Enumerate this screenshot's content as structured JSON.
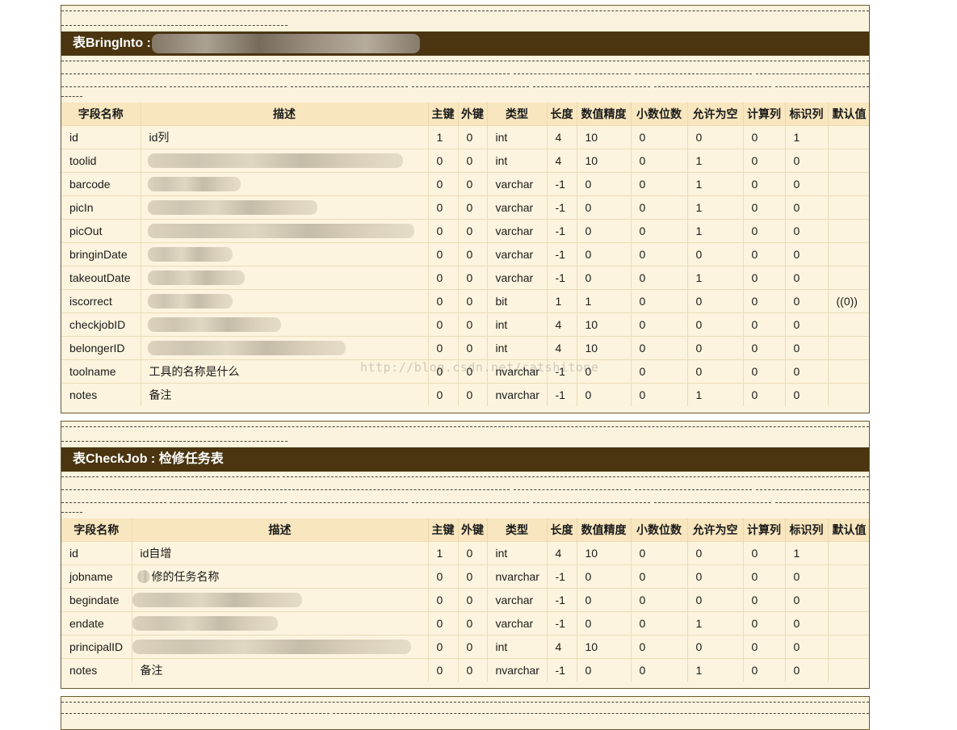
{
  "watermark": "http://blog.csdn.net/catshitone",
  "columns": [
    "字段名称",
    "描述",
    "主键",
    "外键",
    "类型",
    "长度",
    "数值精度",
    "小数位数",
    "允许为空",
    "计算列",
    "标识列",
    "默认值"
  ],
  "tables": [
    {
      "title": "表BringInto :",
      "rows": [
        {
          "name": "id",
          "desc": "id列",
          "pk": "1",
          "fk": "0",
          "type": "int",
          "len": "4",
          "prec": "10",
          "scale": "0",
          "nullable": "0",
          "computed": "0",
          "identity": "1",
          "default": ""
        },
        {
          "name": "toolid",
          "desc": "",
          "pk": "0",
          "fk": "0",
          "type": "int",
          "len": "4",
          "prec": "10",
          "scale": "0",
          "nullable": "1",
          "computed": "0",
          "identity": "0",
          "default": ""
        },
        {
          "name": "barcode",
          "desc": "",
          "pk": "0",
          "fk": "0",
          "type": "varchar",
          "len": "-1",
          "prec": "0",
          "scale": "0",
          "nullable": "1",
          "computed": "0",
          "identity": "0",
          "default": ""
        },
        {
          "name": "picIn",
          "desc": "",
          "pk": "0",
          "fk": "0",
          "type": "varchar",
          "len": "-1",
          "prec": "0",
          "scale": "0",
          "nullable": "1",
          "computed": "0",
          "identity": "0",
          "default": ""
        },
        {
          "name": "picOut",
          "desc": "",
          "pk": "0",
          "fk": "0",
          "type": "varchar",
          "len": "-1",
          "prec": "0",
          "scale": "0",
          "nullable": "1",
          "computed": "0",
          "identity": "0",
          "default": ""
        },
        {
          "name": "bringinDate",
          "desc": "",
          "pk": "0",
          "fk": "0",
          "type": "varchar",
          "len": "-1",
          "prec": "0",
          "scale": "0",
          "nullable": "0",
          "computed": "0",
          "identity": "0",
          "default": ""
        },
        {
          "name": "takeoutDate",
          "desc": "",
          "pk": "0",
          "fk": "0",
          "type": "varchar",
          "len": "-1",
          "prec": "0",
          "scale": "0",
          "nullable": "1",
          "computed": "0",
          "identity": "0",
          "default": ""
        },
        {
          "name": "iscorrect",
          "desc": "",
          "pk": "0",
          "fk": "0",
          "type": "bit",
          "len": "1",
          "prec": "1",
          "scale": "0",
          "nullable": "0",
          "computed": "0",
          "identity": "0",
          "default": "((0))"
        },
        {
          "name": "checkjobID",
          "desc": "",
          "pk": "0",
          "fk": "0",
          "type": "int",
          "len": "4",
          "prec": "10",
          "scale": "0",
          "nullable": "0",
          "computed": "0",
          "identity": "0",
          "default": ""
        },
        {
          "name": "belongerID",
          "desc": "",
          "pk": "0",
          "fk": "0",
          "type": "int",
          "len": "4",
          "prec": "10",
          "scale": "0",
          "nullable": "0",
          "computed": "0",
          "identity": "0",
          "default": ""
        },
        {
          "name": "toolname",
          "desc": "工具的名称是什么",
          "pk": "0",
          "fk": "0",
          "type": "nvarchar",
          "len": "-1",
          "prec": "0",
          "scale": "0",
          "nullable": "0",
          "computed": "0",
          "identity": "0",
          "default": ""
        },
        {
          "name": "notes",
          "desc": "备注",
          "pk": "0",
          "fk": "0",
          "type": "nvarchar",
          "len": "-1",
          "prec": "0",
          "scale": "0",
          "nullable": "1",
          "computed": "0",
          "identity": "0",
          "default": ""
        }
      ]
    },
    {
      "title": "表CheckJob : 检修任务表",
      "rows": [
        {
          "name": "id",
          "desc": "id自增",
          "pk": "1",
          "fk": "0",
          "type": "int",
          "len": "4",
          "prec": "10",
          "scale": "0",
          "nullable": "0",
          "computed": "0",
          "identity": "1",
          "default": ""
        },
        {
          "name": "jobname",
          "desc": "修的任务名称",
          "pk": "0",
          "fk": "0",
          "type": "nvarchar",
          "len": "-1",
          "prec": "0",
          "scale": "0",
          "nullable": "0",
          "computed": "0",
          "identity": "0",
          "default": ""
        },
        {
          "name": "begindate",
          "desc": "",
          "pk": "0",
          "fk": "0",
          "type": "varchar",
          "len": "-1",
          "prec": "0",
          "scale": "0",
          "nullable": "0",
          "computed": "0",
          "identity": "0",
          "default": ""
        },
        {
          "name": "endate",
          "desc": "",
          "pk": "0",
          "fk": "0",
          "type": "varchar",
          "len": "-1",
          "prec": "0",
          "scale": "0",
          "nullable": "1",
          "computed": "0",
          "identity": "0",
          "default": ""
        },
        {
          "name": "principalID",
          "desc": "",
          "pk": "0",
          "fk": "0",
          "type": "int",
          "len": "4",
          "prec": "10",
          "scale": "0",
          "nullable": "0",
          "computed": "0",
          "identity": "0",
          "default": ""
        },
        {
          "name": "notes",
          "desc": "备注",
          "pk": "0",
          "fk": "0",
          "type": "nvarchar",
          "len": "-1",
          "prec": "0",
          "scale": "0",
          "nullable": "1",
          "computed": "0",
          "identity": "0",
          "default": ""
        }
      ]
    }
  ]
}
